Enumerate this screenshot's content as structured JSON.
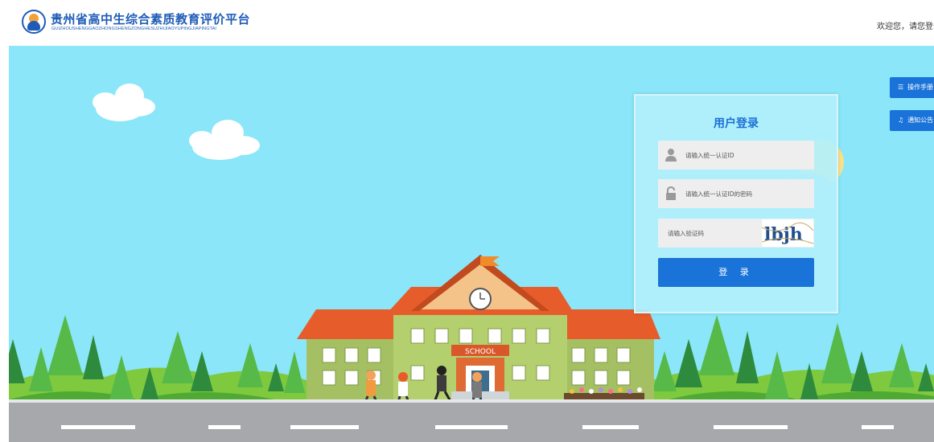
{
  "header": {
    "title": "贵州省高中生综合素质教育评价平台",
    "subtitle": "GUIZHOUSHENGGAOZHONGSHENGZONGHESUZHIJIAOYUPINGJIAPINGTAI",
    "welcome": "欢迎您，请您登录"
  },
  "side_buttons": {
    "manual": {
      "label": "操作手册",
      "icon": "book-icon"
    },
    "notice": {
      "label": "通知公告",
      "icon": "bell-icon"
    }
  },
  "login": {
    "title": "用户登录",
    "id_placeholder": "请输入统一认证ID",
    "password_placeholder": "请输入统一认证ID的密码",
    "captcha_placeholder": "请输入验证码",
    "captcha_text": "lbjh",
    "submit_label": "登 录"
  },
  "scene": {
    "school_sign": "SCHOOL"
  },
  "colors": {
    "brand_blue": "#1f5cb7",
    "button_blue": "#1a73d9",
    "sky": "#8ae6f8",
    "panel": "#b2f0fc"
  }
}
